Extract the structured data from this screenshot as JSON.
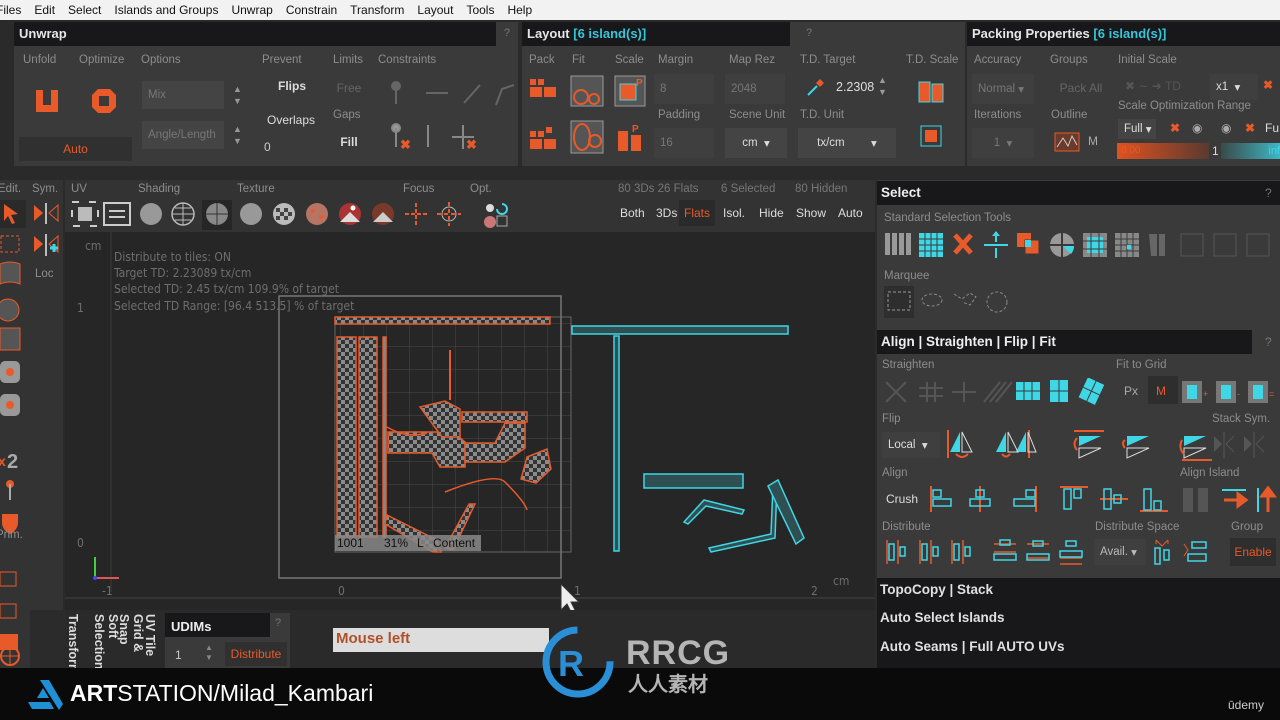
{
  "menu": [
    "Files",
    "Edit",
    "Select",
    "Islands and Groups",
    "Unwrap",
    "Constrain",
    "Transform",
    "Layout",
    "Tools",
    "Help"
  ],
  "unwrap": {
    "title": "Unwrap",
    "help": "?",
    "labels": {
      "unfold": "Unfold",
      "optimize": "Optimize",
      "options": "Options",
      "prevent": "Prevent",
      "limits": "Limits",
      "constraints": "Constraints",
      "gaps": "Gaps"
    },
    "auto": "Auto",
    "opt1": "Mix",
    "opt2": "Angle/Length",
    "flips": "Flips",
    "overlaps": "Overlaps",
    "overlaps_value": "0",
    "free": "Free",
    "fill": "Fill"
  },
  "layout": {
    "title": "Layout",
    "count": "[6 island(s)]",
    "help": "?",
    "labels": {
      "pack": "Pack",
      "fit": "Fit",
      "scale": "Scale",
      "margin": "Margin",
      "map_rez": "Map Rez",
      "td_target": "T.D. Target",
      "td_scale": "T.D. Scale",
      "padding": "Padding",
      "scene_unit": "Scene Unit",
      "td_unit": "T.D. Unit"
    },
    "margin": "8",
    "map_rez": "2048",
    "td_target": "2.2308",
    "padding": "16",
    "scene_unit": "cm",
    "td_unit": "tx/cm"
  },
  "packing": {
    "title": "Packing Properties",
    "count": "[6 island(s)]",
    "labels": {
      "accuracy": "Accuracy",
      "groups": "Groups",
      "initial_scale": "Initial Scale",
      "iterations": "Iterations",
      "outline": "Outline",
      "range": "Scale Optimization Range"
    },
    "accuracy": "Normal",
    "groups": "Pack All",
    "iterations": "1",
    "outline_m": "M",
    "multiplier": "x1",
    "range_mode": "Full",
    "range_mode2": "Fu",
    "range_min": "0.00",
    "range_mid": "1",
    "range_max": "inf"
  },
  "toolbar": {
    "edit": "Edit.",
    "sym": "Sym.",
    "loc": "Loc",
    "prim": "Prim.",
    "uv": "UV",
    "shading": "Shading",
    "texture": "Texture",
    "focus": "Focus",
    "opt": "Opt.",
    "x2": "x2",
    "stats": {
      "counts": "80 3Ds 26 Flats",
      "selected": "6 Selected",
      "hidden": "80 Hidden"
    },
    "view_buttons": [
      "Both",
      "3Ds",
      "Flats",
      "Isol.",
      "Hide",
      "Show",
      "Auto"
    ],
    "active_view": "Flats"
  },
  "viewport": {
    "unit": "cm",
    "unit2": "cm",
    "info": [
      "Distribute to tiles: ON",
      "Target TD: 2.23089 tx/cm",
      "Selected TD: 2.45 tx/cm 109.9% of target",
      "Selected TD Range: [96.4  513.5] % of target"
    ],
    "y_ticks": [
      "1",
      "0"
    ],
    "x_ticks": [
      "-1",
      "0",
      "1",
      "2"
    ],
    "tile": {
      "id": "1001",
      "pct": "31%",
      "l": "L",
      "content": "Content"
    }
  },
  "bottom": {
    "tabs": [
      "Transform",
      "Soft Selection",
      "Grid & Snap",
      "UV Tile"
    ],
    "udims": "UDIMs",
    "help": "?",
    "udim_value": "1",
    "distribute": "Distribute",
    "status": "Mouse left"
  },
  "select": {
    "title": "Select",
    "help": "?",
    "std": "Standard Selection Tools",
    "marquee": "Marquee"
  },
  "align": {
    "title": "Align | Straighten | Flip | Fit",
    "help": "?",
    "straighten": "Straighten",
    "fit_grid": "Fit to Grid",
    "px": "Px",
    "m": "M",
    "flip": "Flip",
    "local": "Local",
    "stack_sym": "Stack Sym.",
    "align": "Align",
    "crush": "Crush",
    "align_island": "Align Island",
    "distribute": "Distribute",
    "dist_space": "Distribute Space",
    "avail": "Avail.",
    "group": "Group",
    "enable": "Enable"
  },
  "sections": [
    "TopoCopy | Stack",
    "Auto Select Islands",
    "Auto Seams | Full AUTO UVs"
  ],
  "footer": {
    "brand_bold": "ART",
    "brand": "STATION/Milad_Kambari",
    "udemy": "ūdemy",
    "watermark": "RRCG",
    "watermark_sub": "人人素材"
  },
  "colors": {
    "accent": "#e85a2a",
    "cyan": "#3fd6e6",
    "panel": "#3a3a3a",
    "header": "#18181b"
  }
}
